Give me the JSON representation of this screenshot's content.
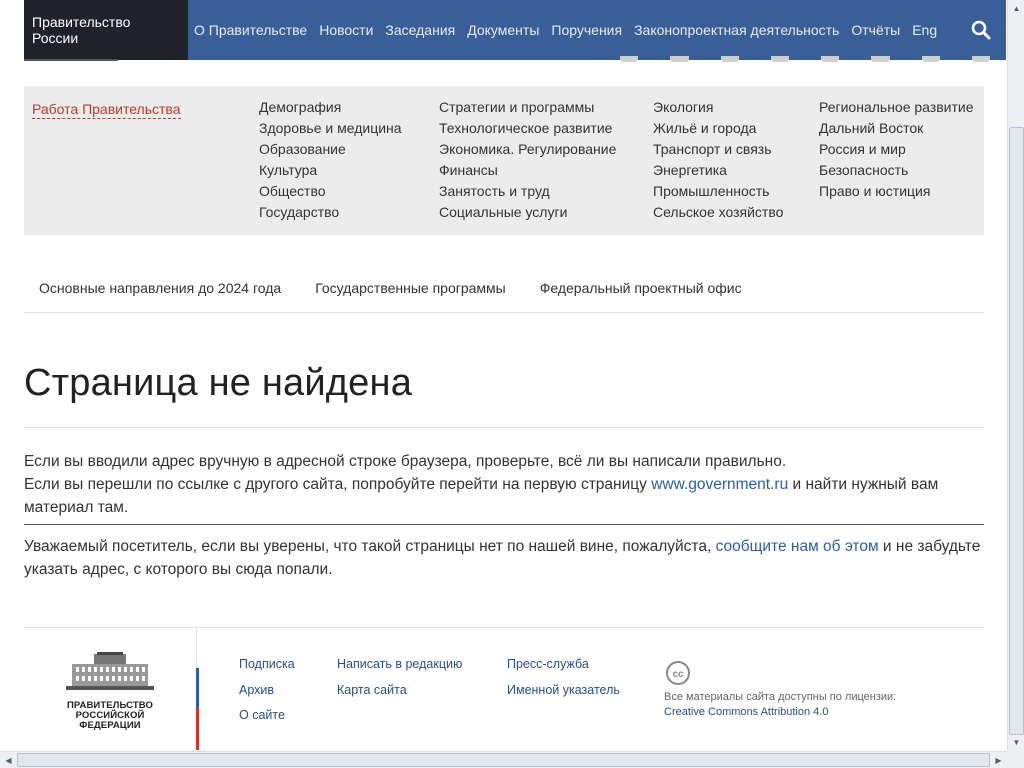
{
  "topnav": {
    "brand": "Правительство России",
    "items": [
      "О Правительстве",
      "Новости",
      "Заседания",
      "Документы",
      "Поручения",
      "Законопроектная деятельность",
      "Отчёты",
      "Eng"
    ]
  },
  "categories": {
    "work_label": "Работа Правительства",
    "col1": [
      "Демография",
      "Здоровье и медицина",
      "Образование",
      "Культура",
      "Общество",
      "Государство"
    ],
    "col2": [
      "Стратегии и программы",
      "Технологическое развитие",
      "Экономика. Регулирование",
      "Финансы",
      "Занятость и труд",
      "Социальные услуги"
    ],
    "col3": [
      "Экология",
      "Жильё и города",
      "Транспорт и связь",
      "Энергетика",
      "Промышленность",
      "Сельское хозяйство"
    ],
    "col4": [
      "Региональное развитие",
      "Дальний Восток",
      "Россия и мир",
      "Безопасность",
      "Право и юстиция"
    ]
  },
  "subnav": [
    "Основные направления до 2024 года",
    "Государственные программы",
    "Федеральный проектный офис"
  ],
  "main": {
    "title": "Страница не найдена",
    "p1_line1": "Если вы вводили адрес вручную в адресной строке браузера, проверьте, всё ли вы написали правильно.",
    "p1_line2_before": "Если вы перешли по ссылке с другого сайта, попробуйте перейти на первую страницу ",
    "p1_link": "www.government.ru",
    "p1_line2_after": " и найти нужный вам материал там.",
    "p2_before": "Уважаемый посетитель, если вы уверены, что такой страницы нет по нашей вине, пожалуйста, ",
    "p2_link": "сообщите нам об этом",
    "p2_after": " и не забудьте указать адрес, с которого вы сюда попали."
  },
  "footer": {
    "logo_caption": "ПРАВИТЕЛЬСТВО РОССИЙСКОЙ ФЕДЕРАЦИИ",
    "col1": [
      "Подписка",
      "Архив",
      "О сайте"
    ],
    "col2": [
      "Написать в редакцию",
      "Карта сайта"
    ],
    "col3": [
      "Пресс-служба",
      "Именной указатель"
    ],
    "license_text": "Все материалы сайта доступны по лицензии:",
    "license_link": "Creative Commons Attribution 4.0"
  },
  "colors": {
    "nav": "#3a5f98",
    "brand_bg": "#1f2329",
    "link": "#2b5da6",
    "work_accent": "#c0392b",
    "flag_blue": "#2e5caa",
    "flag_red": "#d5322d"
  }
}
